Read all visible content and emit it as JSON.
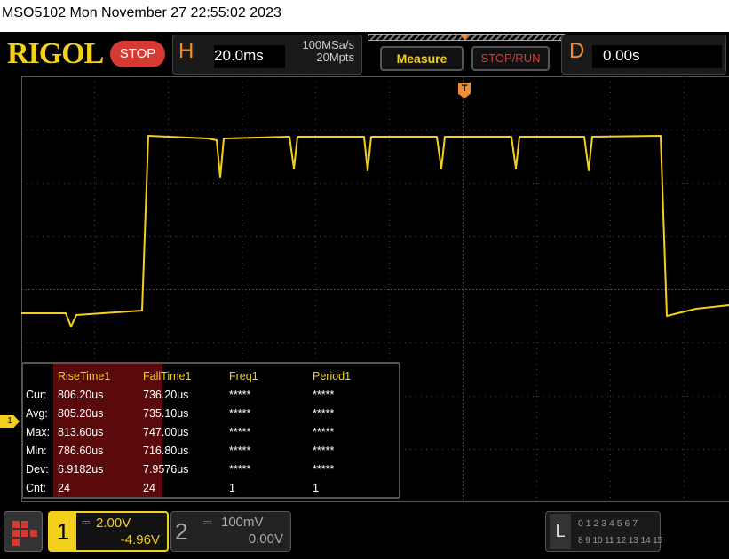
{
  "title_bar": "MSO5102  Mon November 27 22:55:02 2023",
  "brand": "RIGOL",
  "status_button": "STOP",
  "horizontal": {
    "letter": "H",
    "timebase": "20.0ms",
    "sample_rate": "100MSa/s",
    "memory_depth": "20Mpts"
  },
  "measure_button": "Measure",
  "stop_run_button": "STOP/RUN",
  "delay": {
    "letter": "D",
    "value": "0.00s"
  },
  "trigger_marker": "T",
  "channel1_marker": "1",
  "measurements": {
    "row_labels": [
      "Cur:",
      "Avg:",
      "Max:",
      "Min:",
      "Dev:",
      "Cnt:"
    ],
    "columns": [
      {
        "header": "RiseTime1",
        "values": [
          "806.20us",
          "805.20us",
          "813.60us",
          "786.60us",
          "6.9182us",
          "24"
        ]
      },
      {
        "header": "FallTime1",
        "values": [
          "736.20us",
          "735.10us",
          "747.00us",
          "716.80us",
          "7.9576us",
          "24"
        ]
      },
      {
        "header": "Freq1",
        "values": [
          "*****",
          "*****",
          "*****",
          "*****",
          "*****",
          "1"
        ]
      },
      {
        "header": "Period1",
        "values": [
          "*****",
          "*****",
          "*****",
          "*****",
          "*****",
          "1"
        ]
      }
    ]
  },
  "ch1": {
    "number": "1",
    "coupling": "⎓",
    "scale": "2.00V",
    "offset": "-4.96V"
  },
  "ch2": {
    "number": "2",
    "coupling": "⎓",
    "scale": "100mV",
    "offset": "0.00V"
  },
  "logic": {
    "letter": "L",
    "row1": "0 1 2 3  4 5 6 7",
    "row2": "8 9 10 11 12 13 14 15"
  },
  "colors": {
    "ch1": "#f2d01c",
    "trigger": "#f08c2b",
    "stop": "#d63a32",
    "grid": "#5a5a5a",
    "highlight_column": "#5a0a0a"
  }
}
